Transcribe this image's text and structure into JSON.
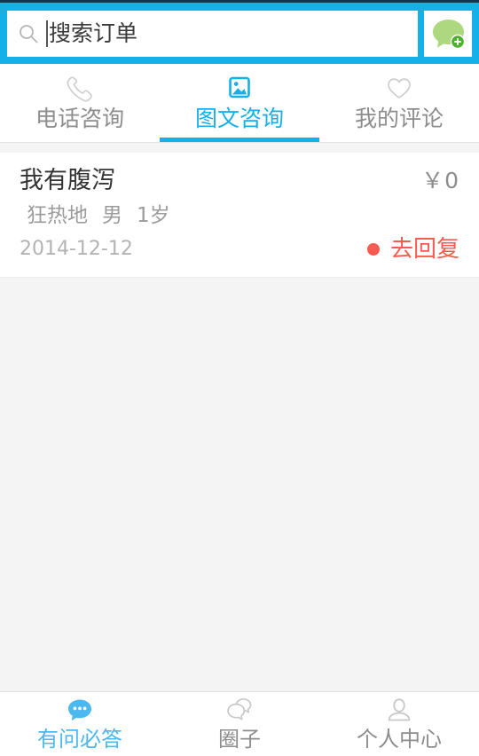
{
  "theme": {
    "primary_blue": "#15b0ea",
    "nav_active_blue": "#4bb8ef",
    "action_red": "#fa5a50",
    "page_bg": "#f4f4f4",
    "card_bg": "#ffffff",
    "muted_text": "#8d8d8d",
    "compose_green_light": "#aed880",
    "compose_green_dark": "#4caf2e"
  },
  "search": {
    "placeholder": "搜索订单",
    "value": "",
    "icon": "search-icon",
    "compose_icon": "new-consultation-icon"
  },
  "tabs": [
    {
      "label": "电话咨询",
      "icon": "phone-icon",
      "active": false
    },
    {
      "label": "图文咨询",
      "icon": "image-icon",
      "active": true
    },
    {
      "label": "我的评论",
      "icon": "heart-icon",
      "active": false
    }
  ],
  "orders": [
    {
      "title": "我有腹泻",
      "price": "￥0",
      "patient_name": "狂热地",
      "gender": "男",
      "age": "1岁",
      "date": "2014-12-12",
      "status_dot": "#fa5a50",
      "action_label": "去回复"
    }
  ],
  "bottom_nav": [
    {
      "label": "有问必答",
      "icon": "chat-bubble-dots-icon",
      "active": true
    },
    {
      "label": "圈子",
      "icon": "double-bubble-icon",
      "active": false
    },
    {
      "label": "个人中心",
      "icon": "person-icon",
      "active": false
    }
  ]
}
